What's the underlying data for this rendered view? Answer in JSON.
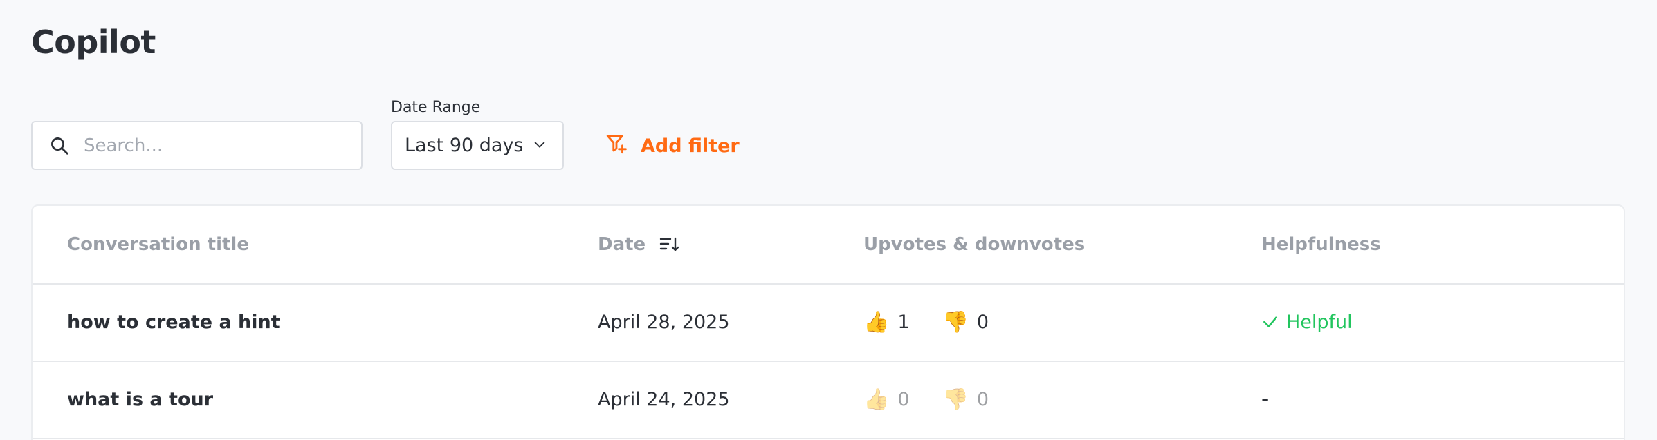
{
  "page": {
    "title": "Copilot"
  },
  "search": {
    "placeholder": "Search...",
    "icon": "search-icon"
  },
  "date_range": {
    "label": "Date Range",
    "value": "Last 90 days",
    "icon": "chevron-down-icon"
  },
  "add_filter": {
    "label": "Add filter",
    "icon": "filter-plus-icon",
    "color": "#ff6a13"
  },
  "table": {
    "columns": {
      "title": "Conversation title",
      "date": "Date",
      "votes": "Upvotes & downvotes",
      "helpfulness": "Helpfulness"
    },
    "rows": [
      {
        "title": "how to create a hint",
        "date": "April 28, 2025",
        "upvotes": "1",
        "downvotes": "0",
        "helpfulness": "Helpful"
      },
      {
        "title": "what is a tour",
        "date": "April 24, 2025",
        "upvotes": "0",
        "downvotes": "0",
        "helpfulness": "-"
      }
    ]
  },
  "colors": {
    "accent": "#ff6a13",
    "helpful": "#22c55e"
  }
}
